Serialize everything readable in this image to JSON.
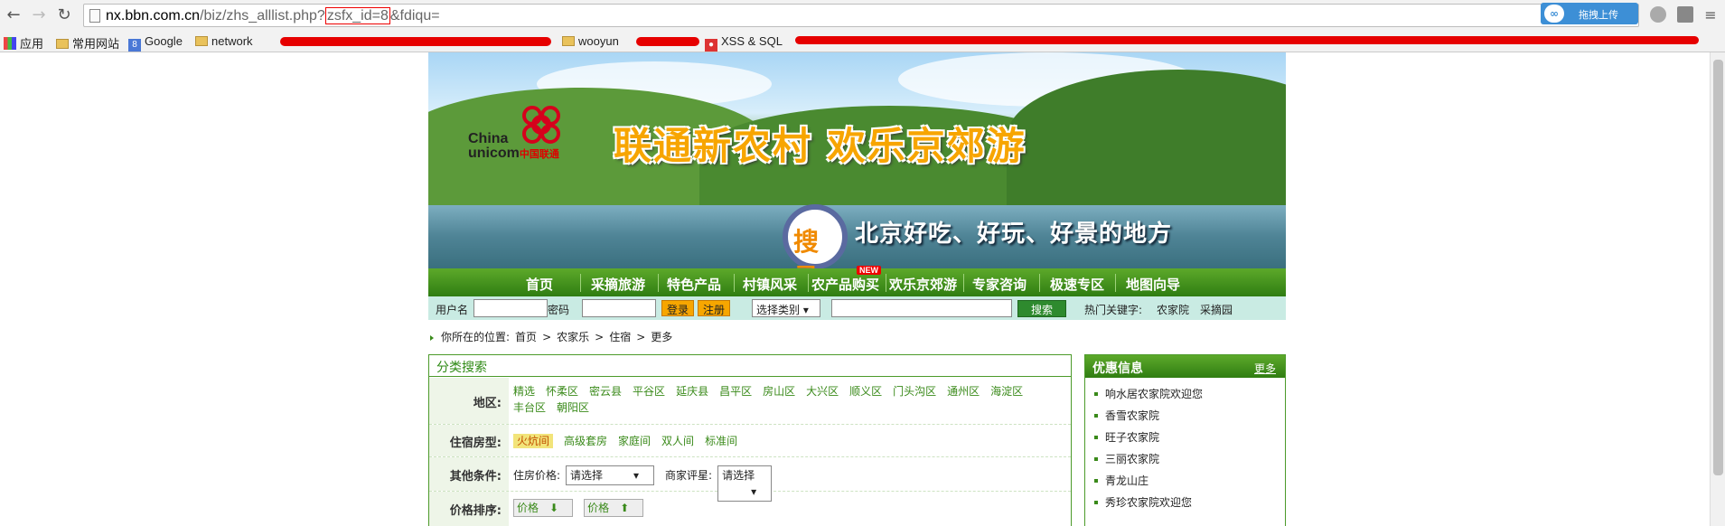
{
  "browser": {
    "url_host": "nx.bbn.com.cn",
    "url_path": "/biz/zhs_alllist.php?",
    "url_highlight": "zsfx_id=8",
    "url_tail": "&fdiqu=",
    "upload_ext_label": "拖拽上传",
    "bookmarks": {
      "apps": "应用",
      "common": "常用网站",
      "google": "Google",
      "network": "network",
      "wooyun": "wooyun",
      "xss": "XSS & SQL"
    }
  },
  "banner": {
    "logo_en_1": "China",
    "logo_en_2": "unicom",
    "logo_cn": "中国联通",
    "slogan": "联通新农村  欢乐京郊游",
    "lens_text": "搜寻",
    "tagline": "北京好吃、好玩、好景的地方"
  },
  "nav": {
    "items": [
      "首页",
      "采摘旅游",
      "特色产品",
      "村镇风采",
      "农产品购买",
      "欢乐京郊游",
      "专家咨询",
      "极速专区",
      "地图向导"
    ],
    "new_badge": "NEW"
  },
  "login": {
    "username_label": "用户名",
    "password_label": "密码",
    "login_button": "登录",
    "register_button": "注册",
    "category_select": "选择类别",
    "search_button": "搜索",
    "hot_label": "热门关键字:",
    "hot_keywords": [
      "农家院",
      "采摘园"
    ]
  },
  "breadcrumb": {
    "label": "你所在的位置:",
    "items": [
      "首页",
      ">",
      "农家乐",
      ">",
      "住宿",
      ">",
      "更多"
    ]
  },
  "category": {
    "title": "分类搜索",
    "region_label": "地区:",
    "regions": [
      "精选",
      "怀柔区",
      "密云县",
      "平谷区",
      "延庆县",
      "昌平区",
      "房山区",
      "大兴区",
      "顺义区",
      "门头沟区",
      "通州区",
      "海淀区",
      "丰台区",
      "朝阳区"
    ],
    "room_label": "住宿房型:",
    "rooms": [
      "火炕间",
      "高级套房",
      "家庭间",
      "双人间",
      "标准间"
    ],
    "other_label": "其他条件:",
    "price_label": "住房价格:",
    "price_select": "请选择",
    "rating_label": "商家评星:",
    "rating_select": "请选择",
    "sort_label": "价格排序:",
    "sort_desc": "价格",
    "sort_asc": "价格"
  },
  "sidebar": {
    "title": "优惠信息",
    "more": "更多",
    "items": [
      "响水居农家院欢迎您",
      "香雪农家院",
      "旺子农家院",
      "三丽农家院",
      "青龙山庄",
      "秀珍农家院欢迎您"
    ]
  }
}
